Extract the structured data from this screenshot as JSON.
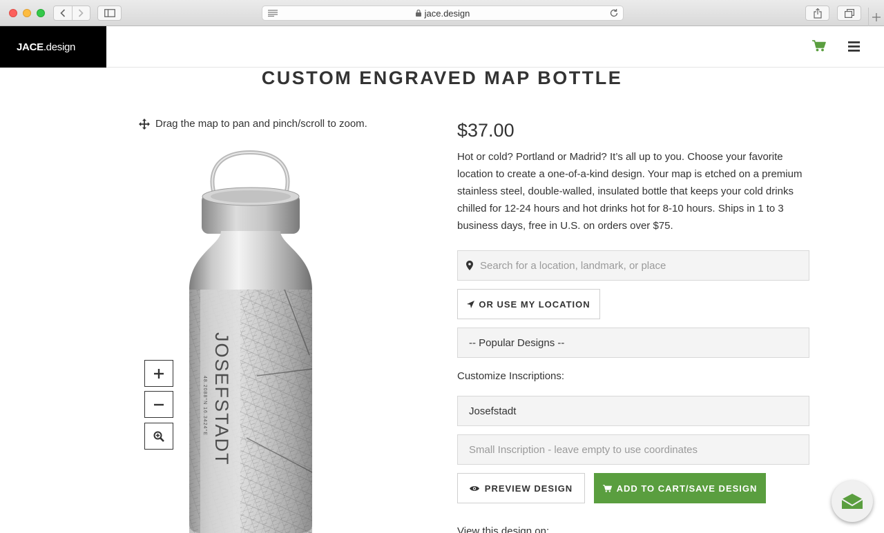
{
  "browser": {
    "url": "jace.design"
  },
  "header": {
    "logo_bold": "JACE",
    "logo_rest": ".design"
  },
  "page": {
    "title": "CUSTOM ENGRAVED MAP BOTTLE",
    "hint": "Drag the map to pan and pinch/scroll to zoom.",
    "price": "$37.00",
    "description": "Hot or cold? Portland or Madrid? It’s all up to you. Choose your favorite location to create a one-of-a-kind design. Your map is etched on a premium stainless steel, double-walled, insulated bottle that keeps your cold drinks chilled for 12-24 hours and hot drinks hot for 8-10 hours. Ships in 1 to 3 business days, free in U.S. on orders over $75.",
    "search_placeholder": "Search for a location, landmark, or place",
    "use_location_label": "OR USE MY LOCATION",
    "popular_designs_selected": "-- Popular Designs --",
    "customize_label": "Customize Inscriptions:",
    "large_inscription_value": "Josefstadt",
    "small_inscription_placeholder": "Small Inscription - leave empty to use coordinates",
    "preview_label": "PREVIEW DESIGN",
    "add_to_cart_label": "ADD TO CART/SAVE DESIGN",
    "view_on": "View this design on:"
  },
  "bottle": {
    "engraved_name": "JOSEFSTADT",
    "engraved_coords": "48.2088°N 16.3424°E"
  },
  "colors": {
    "accent_green": "#5a9e3f",
    "logo_bg": "#000000"
  },
  "icons": [
    "reader-icon",
    "lock-icon",
    "reload-icon",
    "cart-icon",
    "hamburger-menu-icon",
    "move-icon",
    "map-marker-icon",
    "location-arrow-icon",
    "eye-icon",
    "plus-icon",
    "minus-icon",
    "zoom-fit-icon",
    "chat-mail-icon"
  ]
}
